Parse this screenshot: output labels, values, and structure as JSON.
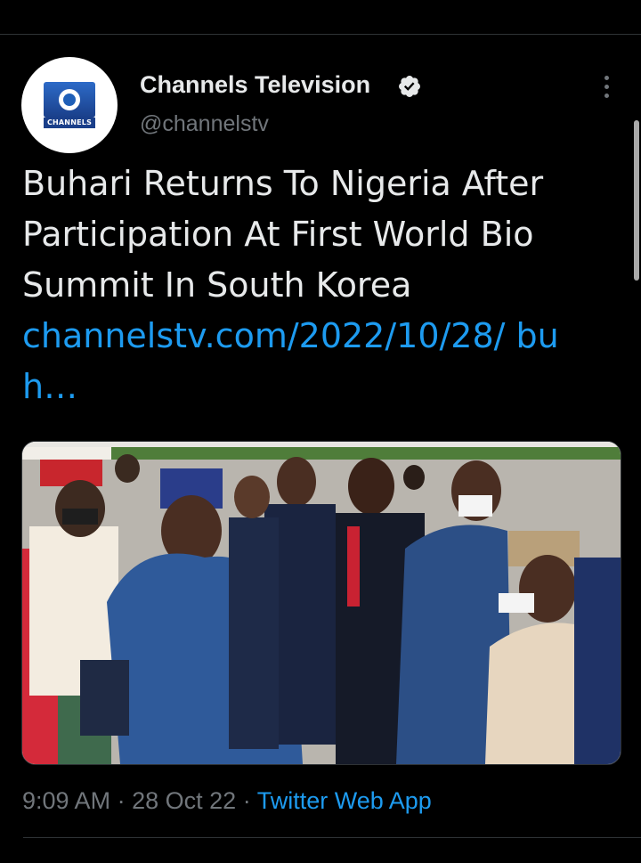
{
  "profile": {
    "display_name": "Channels Television",
    "handle": "@channelstv",
    "avatar_logo_text": "CHANNELS",
    "verified": true
  },
  "tweet": {
    "text": "Buhari Returns To Nigeria After Participation At First World Bio Summit In South Korea",
    "link_text": "channelstv.com/2022/10/28/ buh…"
  },
  "media": {
    "description": "photo"
  },
  "meta": {
    "time": "9:09 AM",
    "date": "28 Oct 22",
    "separator": "·",
    "source": "Twitter Web App"
  },
  "colors": {
    "background": "#000000",
    "text": "#e7e9ea",
    "secondary": "#71767b",
    "accent": "#1d9bf0",
    "divider": "#2f3336"
  },
  "icons": {
    "verified": "verified-badge-icon",
    "more": "more-options-icon"
  }
}
